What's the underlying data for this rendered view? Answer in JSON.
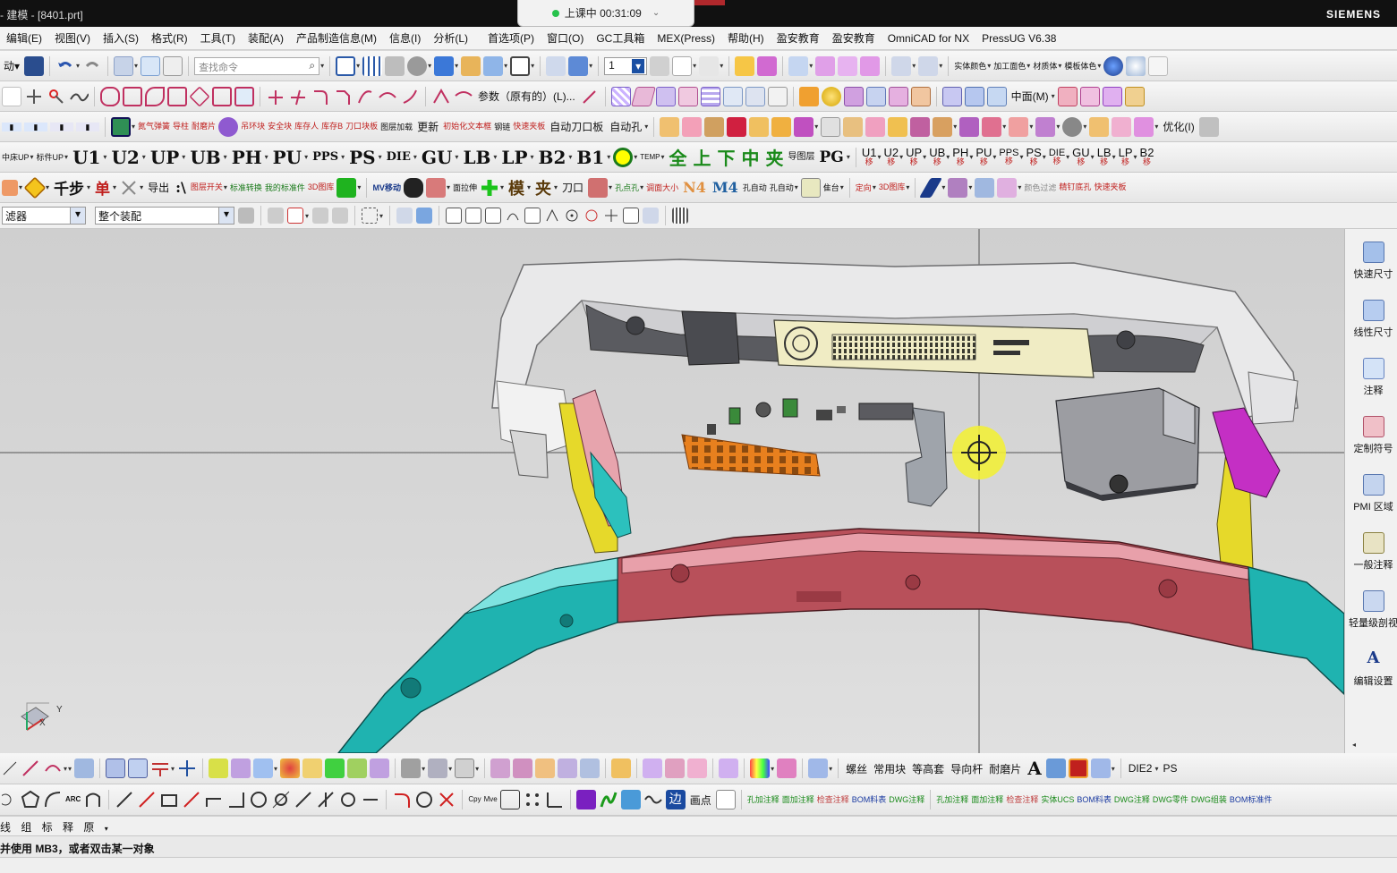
{
  "window": {
    "title": "- 建模 - [8401.prt]",
    "brand": "SIEMENS",
    "class_timer": "上课中 00:31:09"
  },
  "menu": [
    "编辑(E)",
    "视图(V)",
    "插入(S)",
    "格式(R)",
    "工具(T)",
    "装配(A)",
    "产品制造信息(M)",
    "信息(I)",
    "分析(L)",
    "首选项(P)",
    "窗口(O)",
    "GC工具箱",
    "MEX(Press)",
    "帮助(H)",
    "盈安教育",
    "盈安教育",
    "OmniCAD for NX",
    "PressUG V6.38"
  ],
  "toolbar1": {
    "search_placeholder": "查找命令",
    "layer_value": "1",
    "labels": [
      "实体颜色",
      "加工面色",
      "材质体",
      "模板体色"
    ]
  },
  "toolbar2": {
    "param_label": "参数（原有的）(L)...",
    "midplane_label": "中面(M)"
  },
  "toolbar3": {
    "auto_tool_board": "自动刀口板",
    "auto_hole": "自动孔",
    "update": "更新",
    "optimize": "优化(I)",
    "small_labels": [
      "氮气弹簧",
      "导柱",
      "耐磨片",
      "吊环块",
      "安全块",
      "库存人",
      "库存B",
      "刀口块板",
      "图层加载",
      "初始化文本框",
      "钢链",
      "快速夹板"
    ]
  },
  "toolbar4": {
    "labels": [
      "中床UP",
      "标件UP",
      "U1",
      "U2",
      "UP",
      "UB",
      "PH",
      "PU",
      "PPS",
      "PS",
      "DIE",
      "GU",
      "LB",
      "LP",
      "B2",
      "B1",
      "TEMP",
      "全",
      "上",
      "下",
      "中",
      "夹",
      "导图层",
      "PG"
    ],
    "move_labels": [
      "U1",
      "U2",
      "UP",
      "UB",
      "PH",
      "PU",
      "PPS",
      "PS",
      "DIE",
      "GU",
      "LB",
      "LP",
      "B2"
    ],
    "move_sub": "移"
  },
  "toolbar5": {
    "labels": [
      "千步",
      "单",
      "导出",
      ":\\",
      "图层开关",
      "标准转换",
      "我的标准件",
      "3D图库",
      "MV移动",
      "面拉伸",
      "模",
      "夹",
      "刀口",
      "孔点孔",
      "调面大小",
      "N4",
      "M4",
      "孔自动",
      "孔自动",
      "隹台",
      "定向",
      "3D图库",
      "颜色过滤",
      "精钉底孔",
      "快速夹板"
    ]
  },
  "filter": {
    "type_filter": "滤器",
    "scope": "整个装配"
  },
  "rightpanel": [
    "快速尺寸",
    "线性尺寸",
    "注释",
    "定制符号",
    "PMI 区域",
    "一般注释",
    "轻量级剖视",
    "编辑设置"
  ],
  "bottom_toolbar1": {
    "labels": [
      "螺丝",
      "常用块",
      "等高套",
      "导向杆",
      "耐磨片",
      "A",
      "DIE2",
      "PS"
    ]
  },
  "bottom_toolbar2": {
    "labels": [
      "画点",
      "孔加注释",
      "面加注释",
      "检查注释",
      "BOM料表",
      "DWG注释",
      "孔加注释",
      "面加注释",
      "检查注释",
      "实体UCS",
      "BOM料表",
      "DWG注释",
      "DWG零件",
      "DWG组装",
      "BOM标准件"
    ],
    "arc": "ARC"
  },
  "status": {
    "line1": "线 组 标 释 原",
    "line2": "并使用 MB3，或者双击某一对象"
  },
  "colors": {
    "teal_part": "#1fb3b0",
    "red_part": "#b8505a",
    "orange_part": "#e8801e",
    "yellow_part": "#e6d92a",
    "magenta_part": "#c42fc4",
    "cursor_halo": "#f2ef3a"
  },
  "axes_triad": {
    "y": "Y",
    "x": "X"
  }
}
